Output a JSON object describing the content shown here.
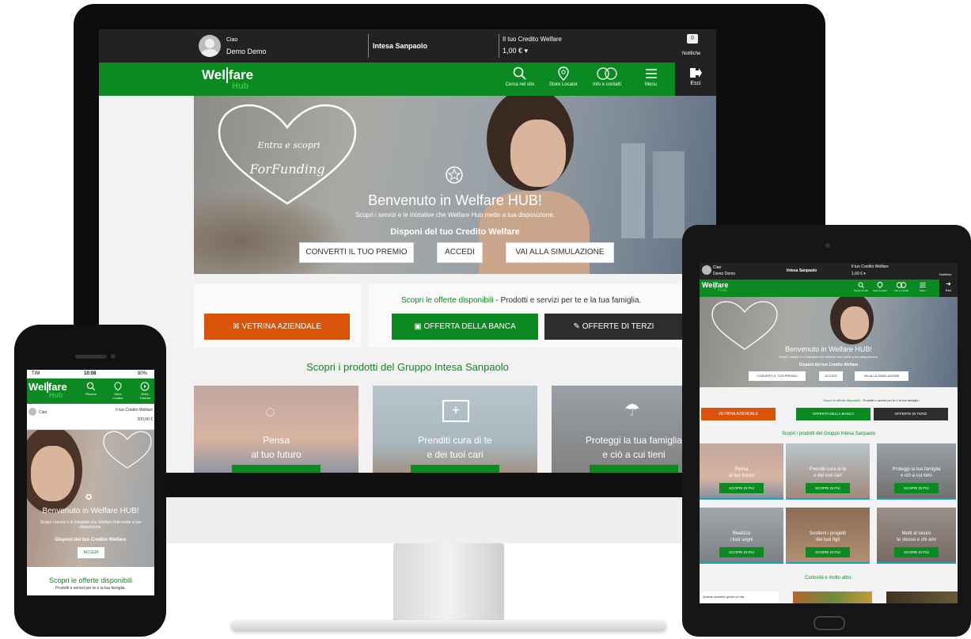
{
  "desktop": {
    "user": {
      "greeting": "Ciao",
      "name": "Demo Demo"
    },
    "bank": "Intesa Sanpaolo",
    "credit": {
      "label": "Il tuo Credito Welfare",
      "amount": "1,00 € ▾"
    },
    "notifications": {
      "count": "0",
      "label": "Notifiche"
    },
    "logo": {
      "part1": "Wel",
      "part2": "fare",
      "hub": "Hub"
    },
    "nav": [
      {
        "label": "Cerca nel sito",
        "icon": "search-icon"
      },
      {
        "label": "Store Locator",
        "icon": "map-pin-icon"
      },
      {
        "label": "Info e contatti",
        "icon": "chat-icon"
      },
      {
        "label": "Menu",
        "icon": "hamburger-icon"
      }
    ],
    "exit_label": "Esci",
    "hero": {
      "script_line1": "Entra e scopri",
      "script_line2": "ForFunding",
      "title": "Benvenuto in Welfare HUB!",
      "subtitle": "Scopri i servizi e le iniziative che Welfare Hub mette a tua disposizione.",
      "credit_prompt": "Disponi del tuo Credito Welfare",
      "buttons": [
        "CONVERTI IL TUO PREMIO",
        "ACCEDI",
        "VAI ALLA SIMULAZIONE"
      ]
    },
    "vetrina_button": "VETRINA AZIENDALE",
    "offers": {
      "title_bold": "Scopri le offerte disponibili",
      "title_rest": " - Prodotti e servizi per te e la tua famiglia.",
      "bank_button": "OFFERTA DELLA BANCA",
      "third_button": "OFFERTE DI TERZI"
    },
    "products_title": "Scopri i prodotti del Gruppo Intesa Sanpaolo",
    "cards": [
      {
        "line1": "Pensa",
        "line2": "al tuo futuro"
      },
      {
        "line1": "Prenditi cura di te",
        "line2": "e dei tuoi cari"
      },
      {
        "line1": "Proteggi la tua famiglia",
        "line2": "e ciò a cui tieni"
      }
    ]
  },
  "phone": {
    "status": {
      "carrier": "TIM",
      "time": "10:08",
      "battery": "80%"
    },
    "logo": {
      "part1": "Wel",
      "part2": "fare",
      "hub": "Hub"
    },
    "nav": [
      "Ricerca",
      "Store Locator",
      "Video Tutorial"
    ],
    "user_greeting": "Ciao",
    "credit_label": "Il tuo Credito Welfare",
    "credit_amount": "200,00 €",
    "hero_title": "Benvenuto in Welfare HUB!",
    "hero_subtitle": "Scopri i servizi e le iniziative che Welfare Hub mette a tua disposizione.",
    "credit_prompt": "Disponi del tuo Credito Welfare",
    "accedi": "ACCEDI",
    "offers_title": "Scopri le offerte disponibili",
    "offers_sub": "Prodotti e servizi per te e la tua famiglia."
  },
  "tablet": {
    "greeting": "Ciao",
    "name": "Demo Demo",
    "bank": "Intesa Sanpaolo",
    "credit_label": "Il tuo Credito Welfare",
    "credit_amount": "1,00 € ▾",
    "notif": "Notifiche",
    "nav": [
      "Cerca nel sito",
      "Store Locator",
      "Info e contatti",
      "Menu"
    ],
    "exit": "Esci",
    "hero_title": "Benvenuto in Welfare HUB!",
    "hero_subtitle": "Scopri i servizi e le iniziative che Welfare Hub mette a tua disposizione.",
    "credit_prompt": "Disponi del tuo Credito Welfare",
    "buttons": [
      "CONVERTI IL TUO PREMIO",
      "ACCEDI",
      "VAI ALLA SIMULAZIONE"
    ],
    "vetrina": "VETRINA AZIENDALE",
    "offers_bold": "Scopri le offerte disponibili",
    "offers_rest": " - Prodotti e servizi per te e la tua famiglia.",
    "bank_button": "OFFERTA DELLA BANCA",
    "third_button": "OFFERTE DI TERZI",
    "products_title": "Scopri i prodotti del Gruppo Intesa Sanpaolo",
    "cards": [
      {
        "l1": "Pensa",
        "l2": "al tuo futuro",
        "btn": "SCOPRI DI PIÙ"
      },
      {
        "l1": "Prenditi cura di te",
        "l2": "e dei tuoi cari",
        "btn": "SCOPRI DI PIÙ"
      },
      {
        "l1": "Proteggi la tua famiglia",
        "l2": "e ciò a cui tieni",
        "btn": "SCOPRI DI PIÙ"
      },
      {
        "l1": "Realizza",
        "l2": "i tuoi sogni",
        "btn": "SCOPRI DI PIÙ"
      },
      {
        "l1": "Sostieni i progetti",
        "l2": "dei tuoi figli",
        "btn": "SCOPRI DI PIÙ"
      },
      {
        "l1": "Metti al sicuro",
        "l2": "te stesso e chi ami",
        "btn": "SCOPRI DI PIÙ"
      }
    ],
    "curiosity_title": "Curiosità e molto altro.",
    "quote": "Quanto sarebbe giusto la vita"
  },
  "colors": {
    "green": "#0b8a22",
    "orange": "#d9530b",
    "dark": "#222222"
  }
}
